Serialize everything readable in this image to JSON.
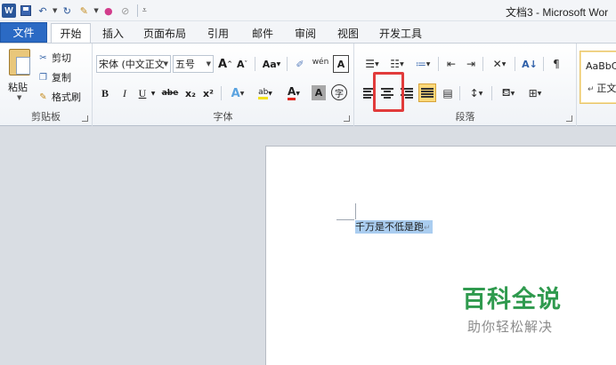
{
  "window": {
    "title": "文档3 - Microsoft Wor"
  },
  "qat": {
    "logo": "W"
  },
  "tabs": [
    {
      "label": "文件"
    },
    {
      "label": "开始"
    },
    {
      "label": "插入"
    },
    {
      "label": "页面布局"
    },
    {
      "label": "引用"
    },
    {
      "label": "邮件"
    },
    {
      "label": "审阅"
    },
    {
      "label": "视图"
    },
    {
      "label": "开发工具"
    }
  ],
  "clipboard": {
    "paste": "粘贴",
    "cut": "剪切",
    "copy": "复制",
    "format_painter": "格式刷",
    "label": "剪贴板"
  },
  "font": {
    "font_name": "宋体 (中文正文",
    "font_size": "五号",
    "grow": "A",
    "shrink": "A",
    "case": "Aa",
    "clear": "",
    "phonetic": "wén",
    "border_char": "A",
    "bold": "B",
    "italic": "I",
    "underline": "U",
    "strike": "abe",
    "subscript": "x₂",
    "superscript": "x²",
    "effects": "A",
    "highlight": "ab",
    "color": "A",
    "shading": "A",
    "enclose": "字",
    "label": "字体"
  },
  "paragraph": {
    "sort": "A↓",
    "label": "段落"
  },
  "styles": {
    "sample": "AaBbCcDc",
    "name": "正文"
  },
  "document": {
    "text": "千万是不低是跑",
    "para_mark": "↵"
  },
  "watermark": {
    "title": "百科全说",
    "subtitle": "助你轻松解决"
  },
  "colors": {
    "file_tab": "#2b6ac4",
    "selection": "#aacdf0",
    "highlight_box": "#e13b3b",
    "watermark": "#2f9a4e"
  }
}
